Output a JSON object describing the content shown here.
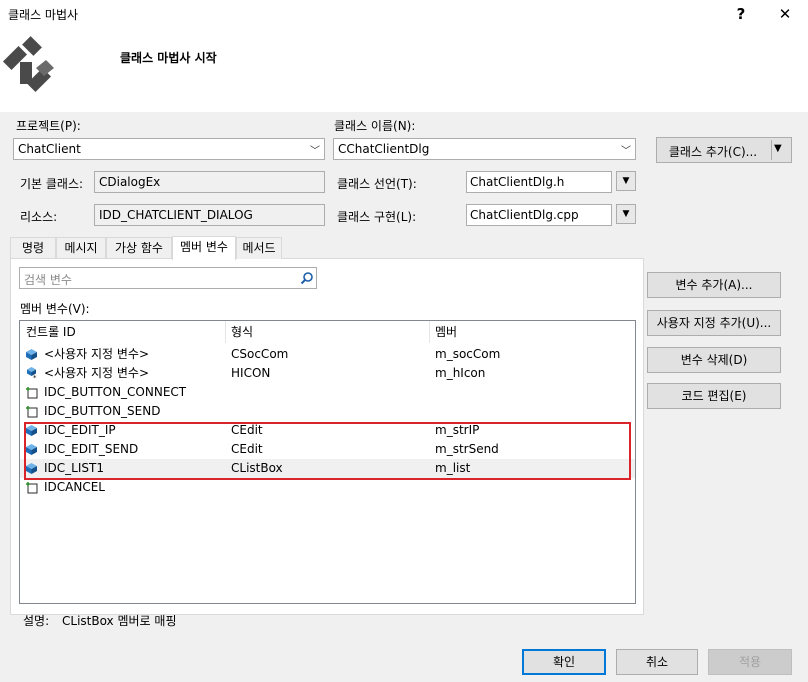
{
  "window": {
    "title": "클래스 마법사",
    "help_label": "?",
    "close_label": "✕"
  },
  "header": {
    "title": "클래스 마법사 시작"
  },
  "project": {
    "label": "프로젝트(P):",
    "value": "ChatClient"
  },
  "class_name": {
    "label": "클래스 이름(N):",
    "value": "CChatClientDlg"
  },
  "add_class": {
    "label": "클래스 추가(C)...",
    "arrow": "▼"
  },
  "base_class": {
    "label": "기본 클래스:",
    "value": "CDialogEx"
  },
  "class_decl": {
    "label": "클래스 선언(T):",
    "value": "ChatClientDlg.h"
  },
  "resource": {
    "label": "리소스:",
    "value": "IDD_CHATCLIENT_DIALOG"
  },
  "class_impl": {
    "label": "클래스 구현(L):",
    "value": "ChatClientDlg.cpp"
  },
  "tabs": [
    {
      "label": "명령"
    },
    {
      "label": "메시지"
    },
    {
      "label": "가상 함수"
    },
    {
      "label": "멤버 변수"
    },
    {
      "label": "메서드"
    }
  ],
  "active_tab": "멤버 변수",
  "search": {
    "placeholder": "검색 변수"
  },
  "member_list": {
    "label": "멤버 변수(V):",
    "columns": [
      "컨트롤 ID",
      "형식",
      "멤버"
    ],
    "rows": [
      {
        "id": "<사용자 지정 변수>",
        "type": "CSocCom",
        "member": "m_socCom",
        "icon": "variable-icon"
      },
      {
        "id": "<사용자 지정 변수>",
        "type": "HICON",
        "member": "m_hIcon",
        "icon": "variable-star-icon"
      },
      {
        "id": "IDC_BUTTON_CONNECT",
        "type": "",
        "member": "",
        "icon": "control-icon"
      },
      {
        "id": "IDC_BUTTON_SEND",
        "type": "",
        "member": "",
        "icon": "control-icon"
      },
      {
        "id": "IDC_EDIT_IP",
        "type": "CEdit",
        "member": "m_strIP",
        "icon": "variable-icon"
      },
      {
        "id": "IDC_EDIT_SEND",
        "type": "CEdit",
        "member": "m_strSend",
        "icon": "variable-icon"
      },
      {
        "id": "IDC_LIST1",
        "type": "CListBox",
        "member": "m_list",
        "icon": "variable-icon"
      },
      {
        "id": "IDCANCEL",
        "type": "",
        "member": "",
        "icon": "control-icon"
      }
    ]
  },
  "side_buttons": {
    "add": "변수 추가(A)...",
    "add_custom": "사용자 지정 추가(U)...",
    "delete": "변수 삭제(D)",
    "edit_code": "코드 편집(E)"
  },
  "description": {
    "label": "설명:",
    "value": "CListBox 멤버로 매핑"
  },
  "footer": {
    "ok": "확인",
    "cancel": "취소",
    "apply": "적용"
  },
  "colors": {
    "highlight_box": "#d9252a",
    "accent": "#0078d7"
  }
}
